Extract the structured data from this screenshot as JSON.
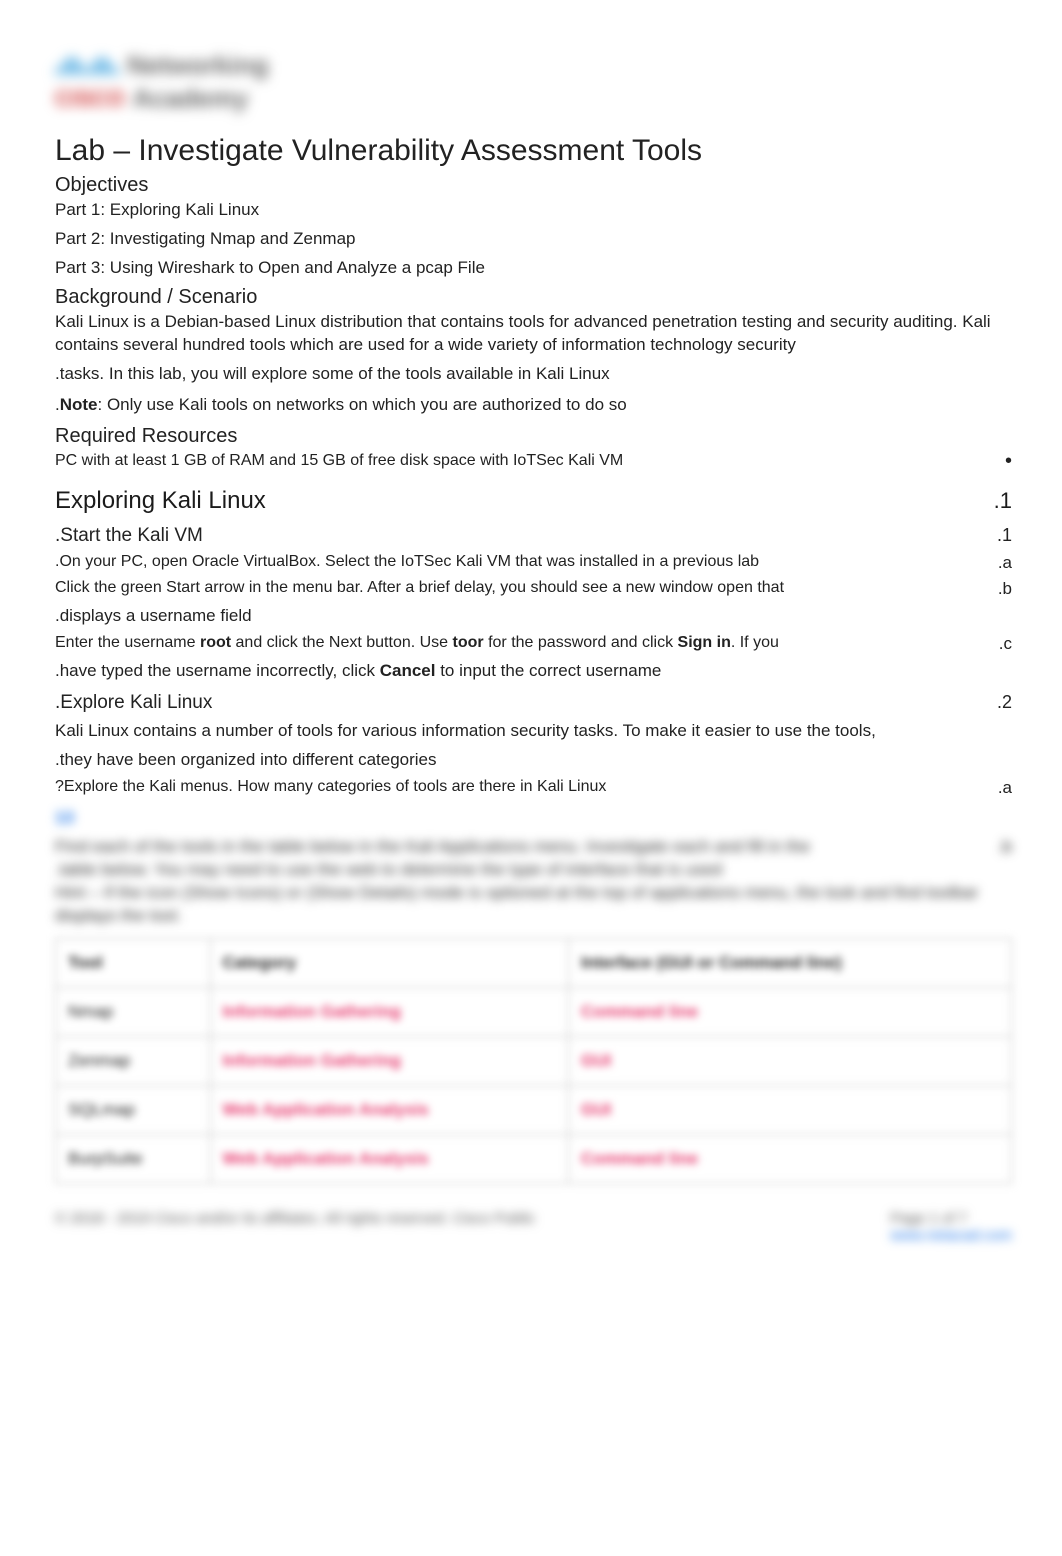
{
  "logo": {
    "networking": "Networking",
    "cisco": "CISCO",
    "academy": "Academy"
  },
  "title": "Lab – Investigate Vulnerability Assessment Tools",
  "objectives": {
    "heading": "Objectives",
    "items": [
      "Part 1: Exploring Kali Linux",
      "Part 2: Investigating Nmap and Zenmap",
      "Part 3: Using Wireshark to Open and Analyze a pcap File"
    ]
  },
  "background": {
    "heading": "Background / Scenario",
    "para": "Kali Linux is a Debian-based Linux distribution that contains tools for advanced penetration testing and security auditing. Kali contains several hundred tools which are used for a wide variety of information technology security",
    "tasks_line": ".tasks. In this lab, you will explore some of the tools available in Kali Linux",
    "note_label": "Note",
    "note_text": ": Only use Kali tools on networks on which you are authorized to do so"
  },
  "required": {
    "heading": "Required Resources",
    "line": "PC with at least 1 GB of RAM and 15 GB of free disk space with IoTSec Kali VM",
    "bullet": "•"
  },
  "section1": {
    "heading": "Exploring Kali Linux",
    "number": ".1",
    "step1": {
      "heading": ".Start the Kali VM",
      "number": ".1",
      "a": ".On your PC, open Oracle VirtualBox. Select the IoTSec Kali VM that was installed in a previous lab",
      "a_marker": ".a",
      "b": "Click the green Start arrow in the menu bar. After a brief delay, you should see a new window open that",
      "b_marker": ".b",
      "b2": ".displays a username field",
      "c_pre": "Enter the username ",
      "c_root": "root",
      "c_mid": " and click the Next button. Use ",
      "c_toor": "toor",
      "c_mid2": " for the password and click ",
      "c_signin": "Sign in",
      "c_post": ". If you",
      "c_marker": ".c",
      "c2_pre": ".have typed the username incorrectly, click ",
      "c2_cancel": "Cancel",
      "c2_post": " to input the correct username"
    },
    "step2": {
      "heading": ".Explore Kali Linux",
      "number": ".2",
      "intro": "Kali Linux contains a number of tools for various information security tasks. To make it easier to use the tools,",
      "intro2": ".they have been organized into different categories",
      "qa": "?Explore the Kali menus. How many categories of tools are there in Kali Linux",
      "qa_marker": ".a",
      "answer13": "13",
      "b_blur_1": "Find each of the tools in the table below in the Kali Applications menu. Investigate each and fill in the",
      "b_blur_marker": ".b",
      "b_blur_2": ".table below. You may need to use the web to determine the type of interface that is used",
      "b_blur_3": "Hint – If the icon (Show Icons) or (Show Details) mode is optioned at the top of applications menu, the look and find toolbar displays the tool."
    }
  },
  "table": {
    "headers": [
      "Tool",
      "Category",
      "Interface (GUI or Command line)"
    ],
    "rows": [
      {
        "tool": "Nmap",
        "category": "Information Gathering",
        "iface": "Command line"
      },
      {
        "tool": "Zenmap",
        "category": "Information Gathering",
        "iface": "GUI"
      },
      {
        "tool": "SQLmap",
        "category": "Web Application Analysis",
        "iface": "GUI"
      },
      {
        "tool": "BurpSuite",
        "category": "Web Application Analysis",
        "iface": "Command line"
      }
    ]
  },
  "footer": {
    "left": "© 2018 - 2019 Cisco and/or its affiliates. All rights reserved. Cisco Public",
    "right_page": "Page 1 of 7",
    "right_link": "www.netacad.com"
  }
}
